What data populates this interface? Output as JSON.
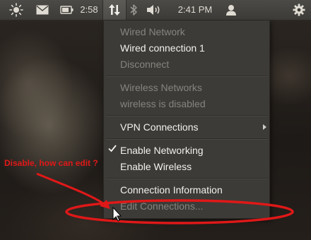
{
  "panel": {
    "battery_time": "2:58",
    "clock": "2:41 PM"
  },
  "icons": {
    "brightness": "sun-icon",
    "mail": "envelope-icon",
    "battery": "battery-icon",
    "network": "network-updown-icon",
    "bluetooth": "bluetooth-icon",
    "volume": "speaker-icon",
    "user": "user-icon",
    "session": "gear-icon"
  },
  "network_menu": {
    "items": [
      {
        "label": "Wired Network",
        "enabled": false
      },
      {
        "label": "Wired connection 1",
        "enabled": true
      },
      {
        "label": "Disconnect",
        "enabled": false
      },
      {
        "label": "Wireless Networks",
        "enabled": false
      },
      {
        "label": "wireless is disabled",
        "enabled": false
      },
      {
        "label": "VPN Connections",
        "enabled": true,
        "submenu": true
      },
      {
        "label": "Enable Networking",
        "enabled": true,
        "checked": true
      },
      {
        "label": "Enable Wireless",
        "enabled": true
      },
      {
        "label": "Connection Information",
        "enabled": true
      },
      {
        "label": "Edit Connections...",
        "enabled": false
      }
    ]
  },
  "annotation": {
    "text": "Disable, how can edit ?",
    "color": "#e01818"
  },
  "colors": {
    "panel_bg": "#3c3b37",
    "menu_bg": "#3c3b37",
    "menu_text": "#f2f1ef",
    "menu_text_disabled": "#86847f"
  }
}
